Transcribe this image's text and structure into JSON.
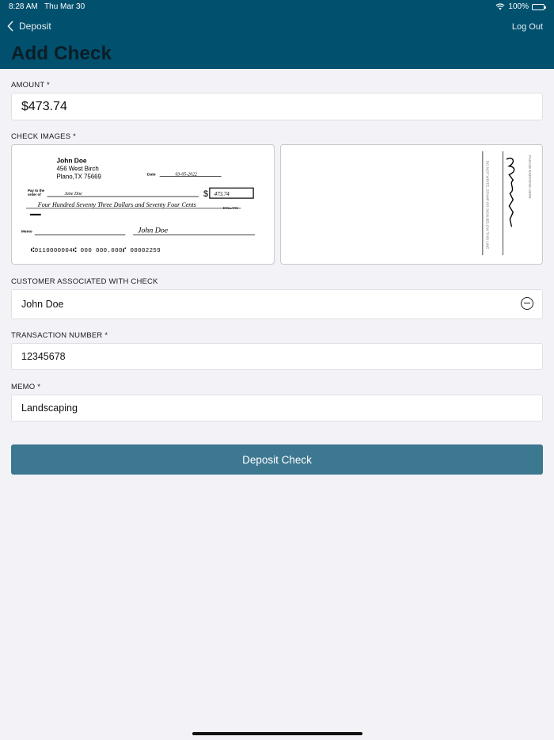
{
  "status": {
    "time": "8:28 AM",
    "date": "Thu Mar 30",
    "battery": "100%"
  },
  "nav": {
    "back_label": "Deposit",
    "logout_label": "Log Out",
    "title": "Add Check"
  },
  "amount": {
    "label": "AMOUNT *",
    "value": "$473.74"
  },
  "check_images": {
    "label": "CHECK IMAGES *",
    "front": {
      "name": "John Doe",
      "address1": "456 West Birch",
      "address2": "Plano,TX 75669",
      "date_label": "Date",
      "date_value": "03-05-2022",
      "pay_to_line1": "Pay to the",
      "pay_to_line2": "order of",
      "payee": "Jane Doe",
      "dollar_sign": "$",
      "amount": "473.74",
      "amount_words": "Four Hundred Seventy Three Dollars and Seventy Four Cents",
      "dollars_label": "DOLLARS",
      "memo_label": "Memo",
      "signature": "John Doe",
      "micr": "⑆0110000004⑆ 000 000.000⑈ 00002259"
    },
    "back": {
      "endorse_text": "PLEASE ENDORSE HERE",
      "warning_text": "DO NOT WRITE, STAMP OR SIGN BELOW THIS LINE"
    }
  },
  "customer": {
    "label": "CUSTOMER ASSOCIATED WITH CHECK",
    "value": "John Doe"
  },
  "transaction": {
    "label": "TRANSACTION NUMBER *",
    "value": "12345678"
  },
  "memo": {
    "label": "MEMO *",
    "value": "Landscaping"
  },
  "deposit_button": {
    "label": "Deposit Check"
  },
  "colors": {
    "header": "#00506e",
    "button": "#3d7891",
    "background": "#f2f2f7"
  }
}
